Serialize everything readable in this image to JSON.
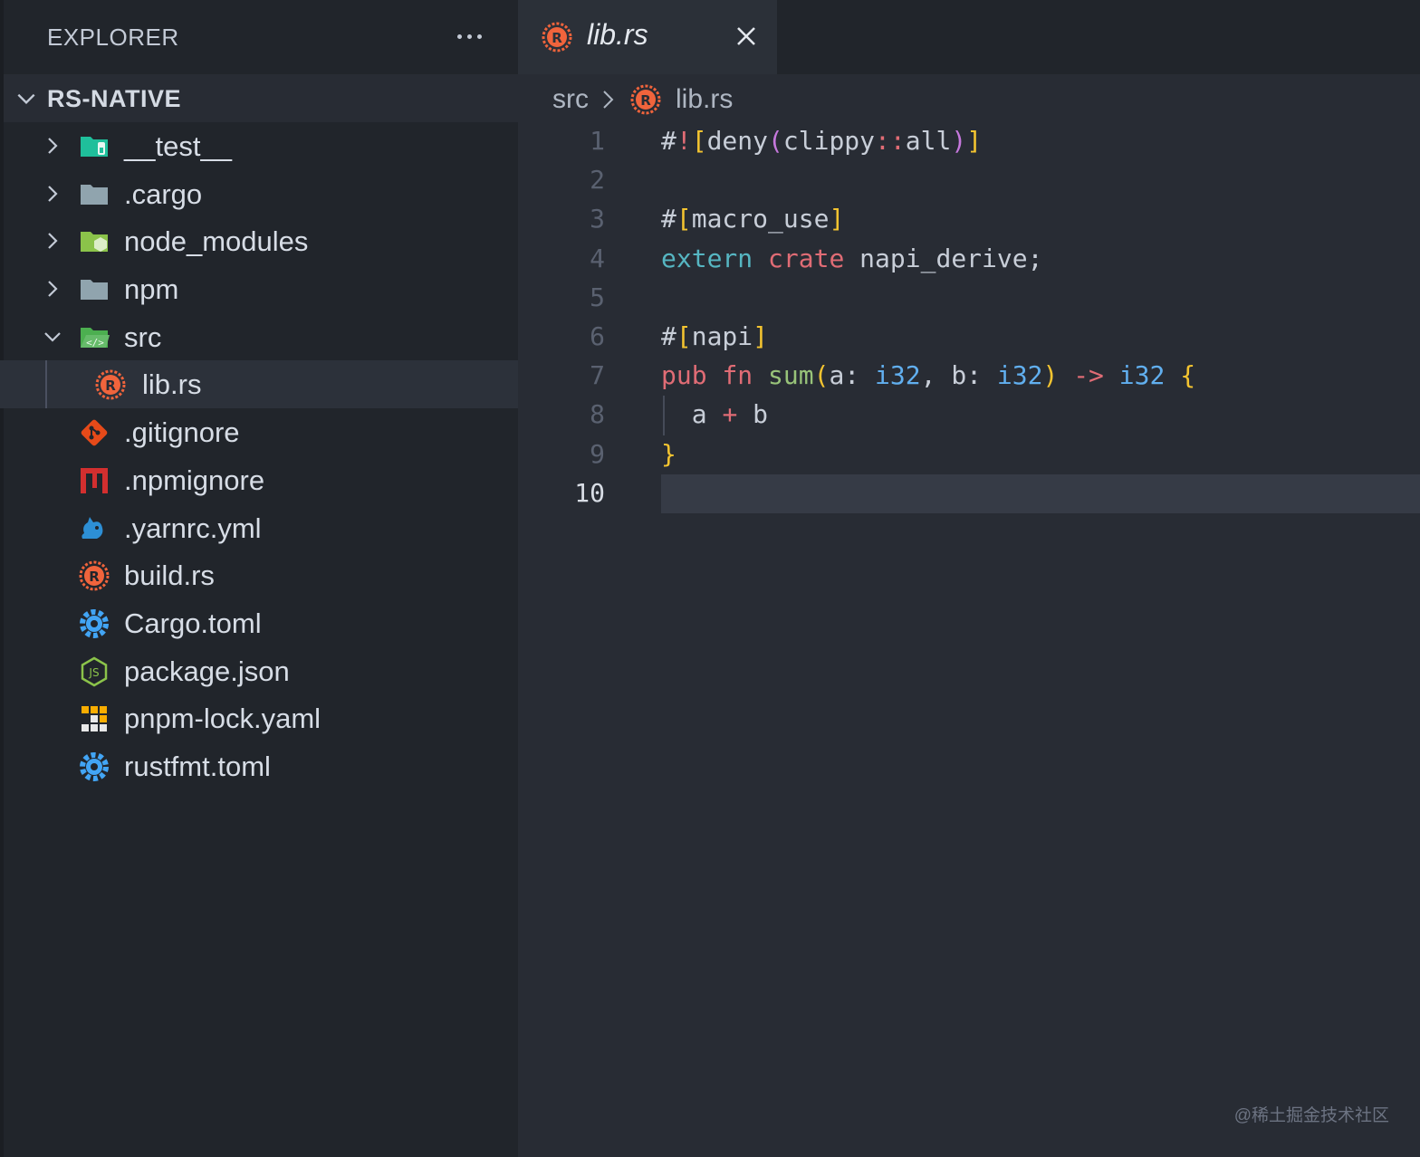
{
  "sidebar": {
    "title": "EXPLORER",
    "section": "RS-NATIVE",
    "items": [
      {
        "label": "__test__",
        "icon": "test-folder-icon",
        "kind": "folder",
        "expanded": false
      },
      {
        "label": ".cargo",
        "icon": "folder-icon",
        "kind": "folder",
        "expanded": false
      },
      {
        "label": "node_modules",
        "icon": "node-folder-icon",
        "kind": "folder",
        "expanded": false
      },
      {
        "label": "npm",
        "icon": "folder-icon",
        "kind": "folder",
        "expanded": false
      },
      {
        "label": "src",
        "icon": "src-folder-icon",
        "kind": "folder",
        "expanded": true
      },
      {
        "label": "lib.rs",
        "icon": "rust-file-icon",
        "kind": "file",
        "selected": true
      },
      {
        "label": ".gitignore",
        "icon": "git-icon",
        "kind": "file"
      },
      {
        "label": ".npmignore",
        "icon": "npm-icon",
        "kind": "file"
      },
      {
        "label": ".yarnrc.yml",
        "icon": "yarn-icon",
        "kind": "file"
      },
      {
        "label": "build.rs",
        "icon": "rust-file-icon",
        "kind": "file"
      },
      {
        "label": "Cargo.toml",
        "icon": "gear-icon",
        "kind": "file"
      },
      {
        "label": "package.json",
        "icon": "nodejs-icon",
        "kind": "file"
      },
      {
        "label": "pnpm-lock.yaml",
        "icon": "pnpm-icon",
        "kind": "file"
      },
      {
        "label": "rustfmt.toml",
        "icon": "gear-icon",
        "kind": "file"
      }
    ]
  },
  "tab": {
    "name": "lib.rs"
  },
  "breadcrumb": {
    "folder": "src",
    "file": "lib.rs"
  },
  "editor": {
    "current_line": 10,
    "lines": [
      [
        [
          "#",
          "punc"
        ],
        [
          "!",
          "red"
        ],
        [
          "[",
          "yel"
        ],
        [
          "deny",
          "txt"
        ],
        [
          "(",
          "mag"
        ],
        [
          "clippy",
          "txt"
        ],
        [
          "::",
          "red"
        ],
        [
          "all",
          "txt"
        ],
        [
          ")",
          "mag"
        ],
        [
          "]",
          "yel"
        ]
      ],
      [],
      [
        [
          "#",
          "punc"
        ],
        [
          "[",
          "yel"
        ],
        [
          "macro_use",
          "txt"
        ],
        [
          "]",
          "yel"
        ]
      ],
      [
        [
          "extern",
          "cyan"
        ],
        [
          " ",
          "txt"
        ],
        [
          "crate",
          "red"
        ],
        [
          " napi_derive;",
          "txt"
        ]
      ],
      [],
      [
        [
          "#",
          "punc"
        ],
        [
          "[",
          "yel"
        ],
        [
          "napi",
          "txt"
        ],
        [
          "]",
          "yel"
        ]
      ],
      [
        [
          "pub",
          "red"
        ],
        [
          " ",
          "txt"
        ],
        [
          "fn",
          "red"
        ],
        [
          " ",
          "txt"
        ],
        [
          "sum",
          "grn"
        ],
        [
          "(",
          "yel"
        ],
        [
          "a: ",
          "txt"
        ],
        [
          "i32",
          "blu"
        ],
        [
          ", b: ",
          "txt"
        ],
        [
          "i32",
          "blu"
        ],
        [
          ")",
          "yel"
        ],
        [
          " ",
          "txt"
        ],
        [
          "->",
          "red"
        ],
        [
          " ",
          "txt"
        ],
        [
          "i32",
          "blu"
        ],
        [
          " ",
          "txt"
        ],
        [
          "{",
          "yel"
        ]
      ],
      [
        [
          "  a ",
          "txt"
        ],
        [
          "+",
          "red"
        ],
        [
          " b",
          "txt"
        ]
      ],
      [
        [
          "}",
          "yel"
        ]
      ],
      []
    ]
  },
  "watermark": "@稀土掘金技术社区",
  "colors": {
    "sidebar_bg": "#21252b",
    "editor_bg": "#282c34",
    "selection": "#2c313a",
    "rust": "#f0643c"
  }
}
